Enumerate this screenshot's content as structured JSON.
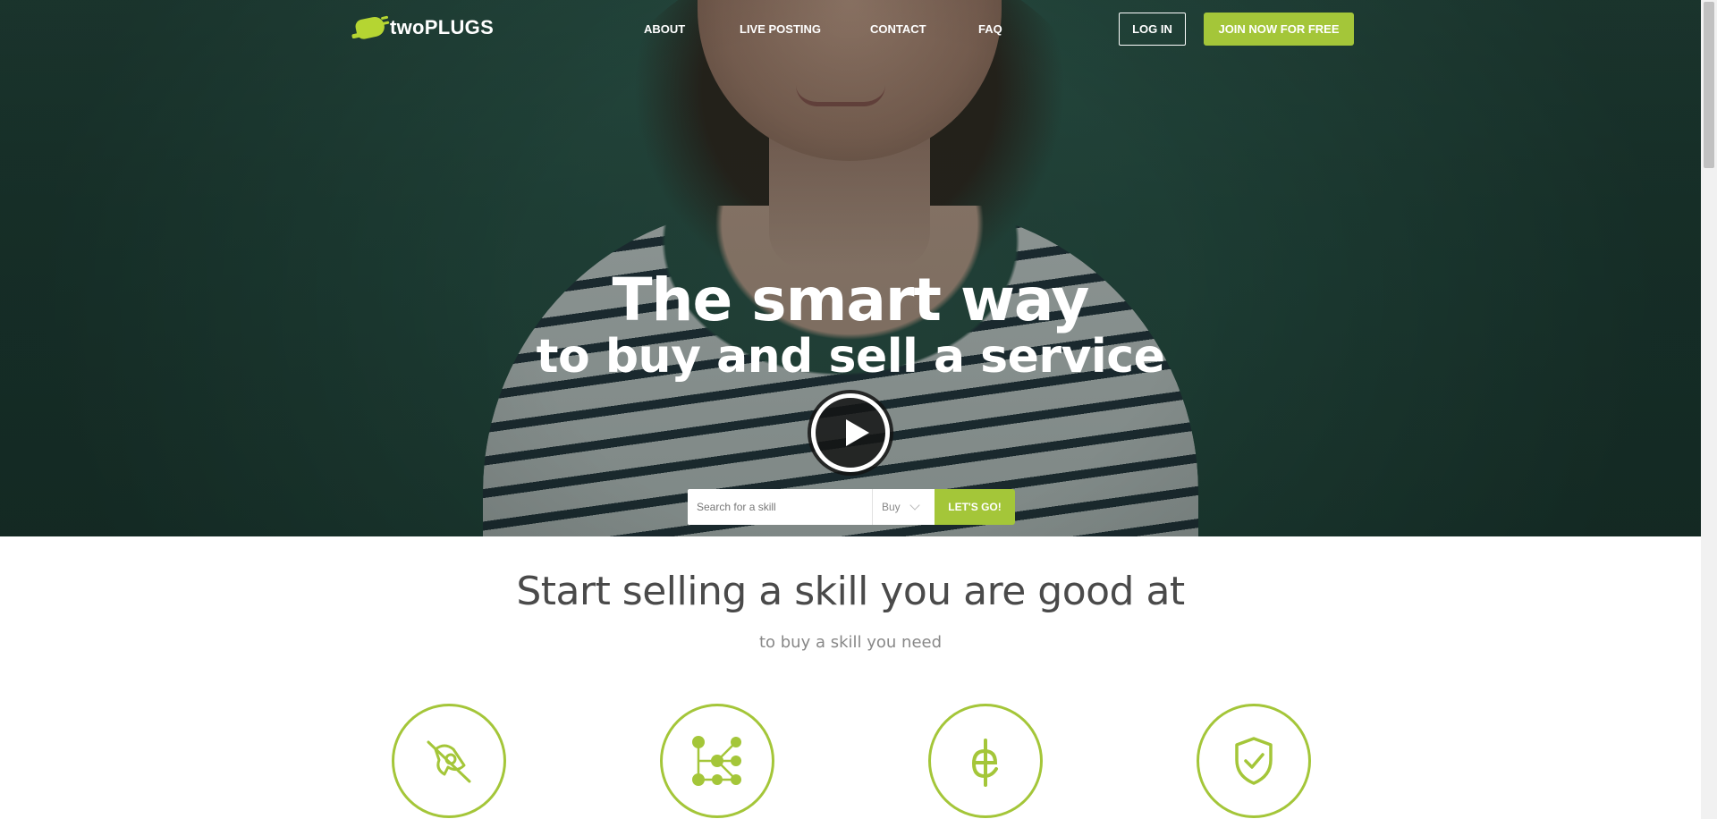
{
  "brand": {
    "name": "twoPLUGS",
    "accent": "#a4c639"
  },
  "nav": {
    "items": [
      {
        "label": "ABOUT"
      },
      {
        "label": "LIVE POSTING"
      },
      {
        "label": "CONTACT"
      },
      {
        "label": "FAQ"
      }
    ],
    "login_label": "LOG IN",
    "join_label": "JOIN NOW FOR FREE"
  },
  "hero": {
    "headline": "The smart way",
    "subheadline": "to buy and sell a service",
    "play_icon": "play-icon"
  },
  "search": {
    "placeholder": "Search for a skill",
    "value": "",
    "mode_selected": "Buy",
    "submit_label": "LET'S GO!"
  },
  "section": {
    "title": "Start selling a skill you are good at",
    "subtitle": "to buy a skill you need"
  },
  "features": [
    {
      "icon": "no-fees-icon"
    },
    {
      "icon": "network-icon"
    },
    {
      "icon": "currency-icon"
    },
    {
      "icon": "shield-check-icon"
    }
  ]
}
